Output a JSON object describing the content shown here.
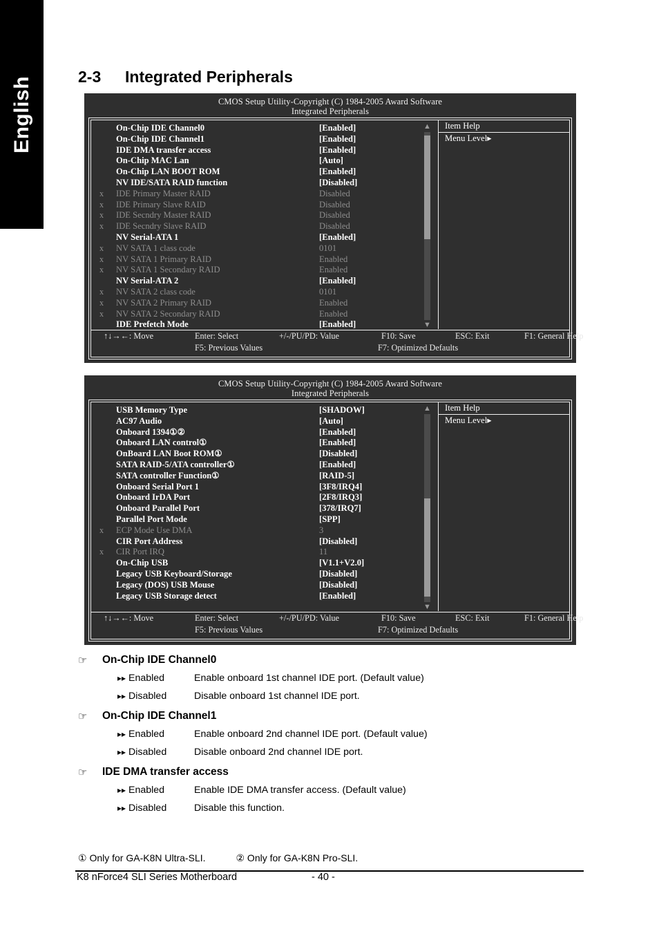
{
  "sidebar": {
    "language_tab": "English"
  },
  "heading": {
    "number": "2-3",
    "title": "Integrated Peripherals"
  },
  "bios_panels": [
    {
      "title_line1": "CMOS Setup Utility-Copyright (C) 1984-2005 Award Software",
      "title_line2": "Integrated Peripherals",
      "item_help": {
        "title": "Item Help",
        "line": "Menu Level▸"
      },
      "scroll": {
        "up_arrow": "▲",
        "down_arrow": "▼",
        "thumb_top_pct": 2,
        "thumb_height_pct": 55
      },
      "rows": [
        {
          "x": "",
          "name": "On-Chip IDE Channel0",
          "value": "[Enabled]",
          "state": "bold"
        },
        {
          "x": "",
          "name": "On-Chip IDE Channel1",
          "value": "[Enabled]",
          "state": "bold"
        },
        {
          "x": "",
          "name": "IDE DMA transfer access",
          "value": "[Enabled]",
          "state": "bold"
        },
        {
          "x": "",
          "name": "On-Chip MAC Lan",
          "value": "[Auto]",
          "state": "bold"
        },
        {
          "x": "",
          "name": "On-Chip LAN BOOT ROM",
          "value": "[Enabled]",
          "state": "bold"
        },
        {
          "x": "",
          "name": "NV IDE/SATA RAID function",
          "value": "[Disabled]",
          "state": "bold"
        },
        {
          "x": "x",
          "name": "IDE Primary Master RAID",
          "value": "Disabled",
          "state": "dim"
        },
        {
          "x": "x",
          "name": "IDE Primary Slave RAID",
          "value": "Disabled",
          "state": "dim"
        },
        {
          "x": "x",
          "name": "IDE Secndry Master RAID",
          "value": "Disabled",
          "state": "dim"
        },
        {
          "x": "x",
          "name": "IDE Secndry Slave RAID",
          "value": "Disabled",
          "state": "dim"
        },
        {
          "x": "",
          "name": "NV Serial-ATA 1",
          "value": "[Enabled]",
          "state": "bold"
        },
        {
          "x": "x",
          "name": "NV SATA 1 class code",
          "value": "0101",
          "state": "dim"
        },
        {
          "x": "x",
          "name": "NV SATA 1 Primary RAID",
          "value": "Enabled",
          "state": "dim"
        },
        {
          "x": "x",
          "name": "NV SATA 1 Secondary RAID",
          "value": "Enabled",
          "state": "dim"
        },
        {
          "x": "",
          "name": "NV Serial-ATA 2",
          "value": "[Enabled]",
          "state": "bold"
        },
        {
          "x": "x",
          "name": "NV SATA 2 class code",
          "value": "0101",
          "state": "dim"
        },
        {
          "x": "x",
          "name": "NV SATA 2 Primary RAID",
          "value": "Enabled",
          "state": "dim"
        },
        {
          "x": "x",
          "name": "NV SATA 2 Secondary RAID",
          "value": "Enabled",
          "state": "dim"
        },
        {
          "x": "",
          "name": "IDE Prefetch Mode",
          "value": "[Enabled]",
          "state": "bold"
        }
      ],
      "keys_line1": [
        "↑↓→←: Move",
        "Enter: Select",
        "+/-/PU/PD: Value",
        "F10: Save",
        "ESC: Exit",
        "F1: General Help"
      ],
      "keys_line2": [
        "F5: Previous Values",
        "F7: Optimized Defaults"
      ]
    },
    {
      "title_line1": "CMOS Setup Utility-Copyright (C) 1984-2005 Award Software",
      "title_line2": "Integrated Peripherals",
      "item_help": {
        "title": "Item Help",
        "line": "Menu Level▸"
      },
      "scroll": {
        "up_arrow": "▲",
        "down_arrow": "▼",
        "thumb_top_pct": 45,
        "thumb_height_pct": 52
      },
      "rows": [
        {
          "x": "",
          "name": "USB Memory Type",
          "value": "[SHADOW]",
          "state": "bold"
        },
        {
          "x": "",
          "name": "AC97 Audio",
          "value": "[Auto]",
          "state": "bold"
        },
        {
          "x": "",
          "name": "Onboard 1394①②",
          "value": "[Enabled]",
          "state": "bold"
        },
        {
          "x": "",
          "name": "Onboard LAN control①",
          "value": "[Enabled]",
          "state": "bold"
        },
        {
          "x": "",
          "name": "OnBoard LAN Boot ROM①",
          "value": "[Disabled]",
          "state": "bold"
        },
        {
          "x": "",
          "name": "SATA RAID-5/ATA controller①",
          "value": "[Enabled]",
          "state": "bold"
        },
        {
          "x": "",
          "name": "SATA controller Function①",
          "value": "[RAID-5]",
          "state": "bold"
        },
        {
          "x": "",
          "name": "Onboard Serial Port 1",
          "value": "[3F8/IRQ4]",
          "state": "bold"
        },
        {
          "x": "",
          "name": "Onboard IrDA Port",
          "value": "[2F8/IRQ3]",
          "state": "bold"
        },
        {
          "x": "",
          "name": "Onboard Parallel Port",
          "value": "[378/IRQ7]",
          "state": "bold"
        },
        {
          "x": "",
          "name": "Parallel Port Mode",
          "value": "[SPP]",
          "state": "bold"
        },
        {
          "x": "x",
          "name": "ECP Mode Use DMA",
          "value": "3",
          "state": "dim"
        },
        {
          "x": "",
          "name": "CIR Port Address",
          "value": "[Disabled]",
          "state": "bold"
        },
        {
          "x": "x",
          "name": "CIR Port IRQ",
          "value": "11",
          "state": "dim"
        },
        {
          "x": "",
          "name": "On-Chip USB",
          "value": "[V1.1+V2.0]",
          "state": "bold"
        },
        {
          "x": "",
          "name": "Legacy USB Keyboard/Storage",
          "value": "[Disabled]",
          "state": "bold"
        },
        {
          "x": "",
          "name": "Legacy (DOS) USB Mouse",
          "value": "[Disabled]",
          "state": "bold"
        },
        {
          "x": "",
          "name": "Legacy USB Storage detect",
          "value": "[Enabled]",
          "state": "bold"
        }
      ],
      "keys_line1": [
        "↑↓→←: Move",
        "Enter: Select",
        "+/-/PU/PD: Value",
        "F10: Save",
        "ESC: Exit",
        "F1: General Help"
      ],
      "keys_line2": [
        "F5: Previous Values",
        "F7: Optimized Defaults"
      ]
    }
  ],
  "descriptions": [
    {
      "hand": "☞",
      "title": "On-Chip IDE Channel0",
      "options": [
        {
          "bullet": "▸▸",
          "name": "Enabled",
          "text": "Enable onboard 1st channel IDE port. (Default value)"
        },
        {
          "bullet": "▸▸",
          "name": "Disabled",
          "text": "Disable onboard 1st channel IDE port."
        }
      ]
    },
    {
      "hand": "☞",
      "title": "On-Chip IDE Channel1",
      "options": [
        {
          "bullet": "▸▸",
          "name": "Enabled",
          "text": "Enable onboard 2nd channel IDE port. (Default value)"
        },
        {
          "bullet": "▸▸",
          "name": "Disabled",
          "text": "Disable onboard 2nd channel IDE port."
        }
      ]
    },
    {
      "hand": "☞",
      "title": "IDE DMA transfer access",
      "options": [
        {
          "bullet": "▸▸",
          "name": "Enabled",
          "text": "Enable IDE DMA transfer access. (Default value)"
        },
        {
          "bullet": "▸▸",
          "name": "Disabled",
          "text": "Disable this function."
        }
      ]
    }
  ],
  "notes": {
    "note1": "① Only for GA-K8N Ultra-SLI.",
    "note2": "② Only for GA-K8N Pro-SLI."
  },
  "footer": {
    "product": "K8 nForce4 SLI Series Motherboard",
    "page": "- 40 -"
  },
  "colors": {
    "bios_background": "#2f2f2f",
    "bios_border": "#f2f2f2",
    "bios_text": "#e8e8e8",
    "bios_dim_text": "#8d8d8d",
    "tab_background": "#000000",
    "page_background": "#ffffff"
  }
}
